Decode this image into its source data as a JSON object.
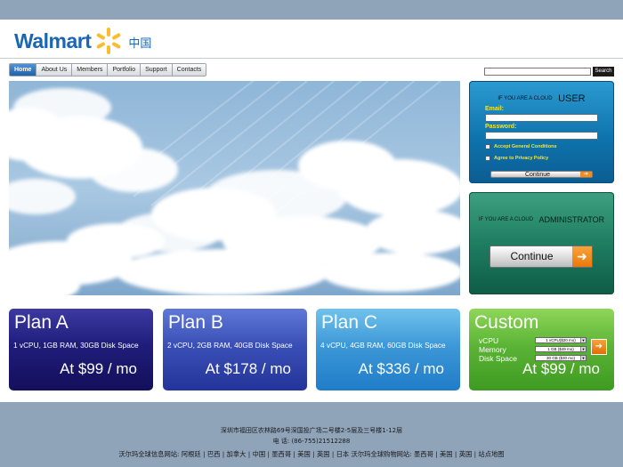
{
  "header": {
    "logo_text": "Walmart",
    "logo_region": "中国",
    "brand_blue": "#1a66b3",
    "brand_yellow": "#fdbb30"
  },
  "nav": {
    "items": [
      {
        "label": "Home",
        "active": true
      },
      {
        "label": "About Us",
        "active": false
      },
      {
        "label": "Members",
        "active": false
      },
      {
        "label": "Portfolio",
        "active": false
      },
      {
        "label": "Support",
        "active": false
      },
      {
        "label": "Contacts",
        "active": false
      }
    ]
  },
  "search": {
    "value": "",
    "button_label": "Search"
  },
  "login_user": {
    "prefix": "IF YOU ARE A CLOUD",
    "role": "USER",
    "email_label": "Email:",
    "email_value": "",
    "password_label": "Password:",
    "password_value": "",
    "accept_label": "Accept General Conditions",
    "privacy_label": "Agree to Privacy Policy",
    "button_label": "Continue",
    "button_arrow": "➜"
  },
  "login_admin": {
    "prefix": "IF YOU ARE A CLOUD",
    "role": "ADMINISTRATOR",
    "button_label": "Continue",
    "button_arrow": "➜"
  },
  "plans": [
    {
      "name": "Plan A",
      "spec": "1 vCPU, 1GB RAM, 30GB Disk Space",
      "price": "At $99 / mo"
    },
    {
      "name": "Plan B",
      "spec": "2 vCPU, 2GB RAM, 40GB Disk Space",
      "price": "At $178 / mo"
    },
    {
      "name": "Plan C",
      "spec": "4 vCPU, 4GB RAM, 60GB Disk Space",
      "price": "At $336 / mo"
    }
  ],
  "custom_plan": {
    "name": "Custom",
    "vcpu_label": "vCPU",
    "vcpu_value": "1 vCPU($20 mo)",
    "memory_label": "Memory",
    "memory_value": "1 GB ($49 mo)",
    "disk_label": "Disk Space",
    "disk_value": "30 GB ($30 mo)",
    "price": "At $99 / mo",
    "button_arrow": "➜"
  },
  "footer": {
    "address": "深圳市福田区农林路69号深国投广场二号楼2-5层及三号楼1-12层",
    "phone": "电 话: (86-755)21512288",
    "links": [
      "沃尔玛全球信息网站: 阿根廷",
      "巴西",
      "加拿大",
      "中国",
      "墨西哥",
      "美国",
      "英国",
      "日本 沃尔玛全球购物网站: 墨西哥",
      "美国",
      "英国",
      "站点地图"
    ],
    "separator": " | "
  }
}
